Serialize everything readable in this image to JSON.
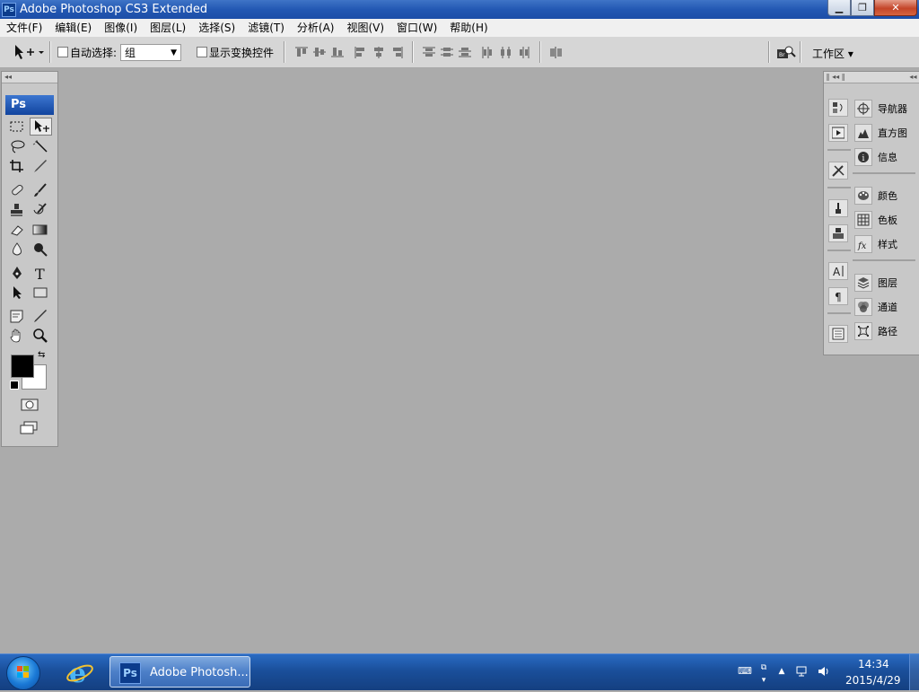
{
  "window": {
    "title": "Adobe Photoshop CS3 Extended",
    "app_icon_text": "Ps",
    "minimize": "▁",
    "maximize": "❐",
    "close": "✕"
  },
  "menu": [
    "文件(F)",
    "编辑(E)",
    "图像(I)",
    "图层(L)",
    "选择(S)",
    "滤镜(T)",
    "分析(A)",
    "视图(V)",
    "窗口(W)",
    "帮助(H)"
  ],
  "options": {
    "auto_select_label": "自动选择:",
    "auto_select_value": "组",
    "show_transform_label": "显示变换控件",
    "workspace_label": "工作区 ▾"
  },
  "tools": {
    "logo": "Ps"
  },
  "dock": {
    "panels": [
      "导航器",
      "直方图",
      "信息",
      "颜色",
      "色板",
      "样式",
      "图层",
      "通道",
      "路径"
    ]
  },
  "taskbar": {
    "task_label": "Adobe Photosh...",
    "task_icon_text": "Ps",
    "time": "14:34",
    "date": "2015/4/29"
  },
  "colors": {
    "workspace_bg": "#ababab",
    "title_blue": "#2358b3",
    "foreground_color": "#000000",
    "background_color": "#ffffff"
  }
}
